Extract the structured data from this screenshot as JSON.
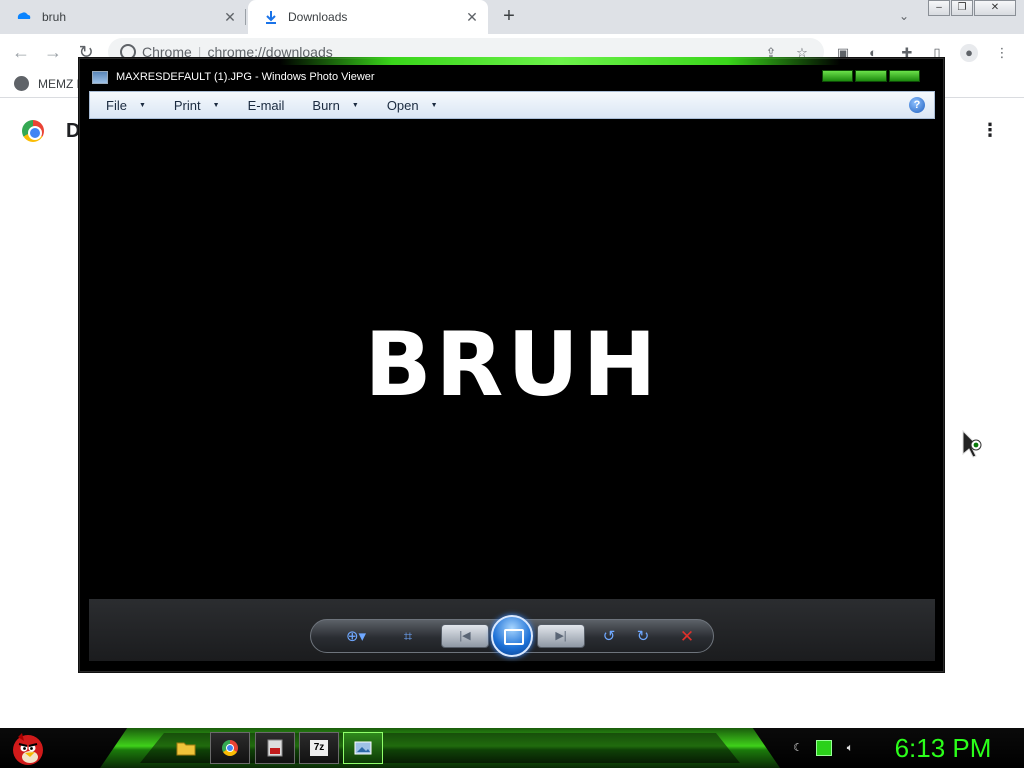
{
  "browser": {
    "tabs": [
      {
        "title": "bruh",
        "icon": "edge-cloud-icon"
      },
      {
        "title": "Downloads",
        "icon": "download-icon"
      }
    ],
    "new_tab_label": "+",
    "tab_close_glyph": "✕",
    "address": {
      "site_label": "Chrome",
      "url": "chrome://downloads"
    },
    "bookmark": {
      "label": "MEMZ D"
    },
    "page": {
      "title": "D"
    }
  },
  "photo_viewer": {
    "title": "MAXRESDEFAULT (1).JPG - Windows Photo Viewer",
    "menus": [
      "File",
      "Print",
      "E-mail",
      "Burn",
      "Open"
    ],
    "help_glyph": "?",
    "image_text": "BRUH",
    "controls": [
      "zoom",
      "fit",
      "previous",
      "slideshow",
      "next",
      "rotate-counterclockwise",
      "rotate-clockwise",
      "delete"
    ]
  },
  "taskbar": {
    "apps": [
      "angry-birds-start-icon",
      "file-explorer-icon",
      "chrome-icon",
      "media-app-icon",
      "7zip-icon",
      "photo-viewer-icon"
    ],
    "app_labels": {
      "sevenzip": "7z"
    },
    "clock": "6:13 PM",
    "accent_color": "#2bff1a"
  },
  "colors": {
    "tabstrip": "#dee1e6",
    "viewer_background": "#000000",
    "taskbar_glow": "#3fd11a"
  }
}
